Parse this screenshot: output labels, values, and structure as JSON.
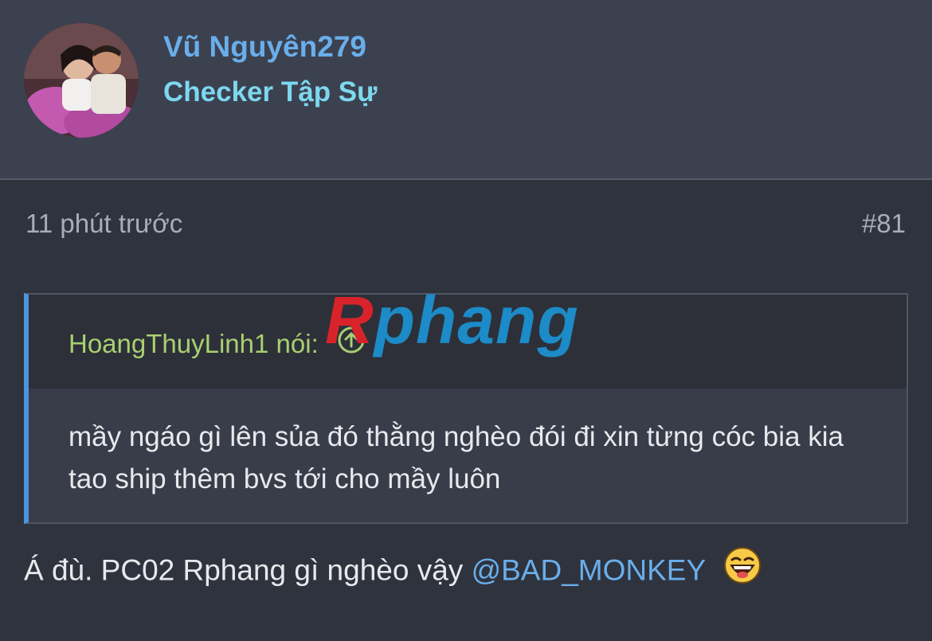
{
  "user": {
    "name": "Vũ Nguyên279",
    "title": "Checker Tập Sự"
  },
  "post": {
    "time": "11 phút trước",
    "number": "#81"
  },
  "quote": {
    "author": "HoangThuyLinh1",
    "said": "nói:",
    "arrow_icon": "arrow-up-circle-icon",
    "text": "mầy ngáo gì lên sủa đó thằng nghèo đói đi xin từng cóc bia kia tao ship thêm bvs tới cho mầy luôn"
  },
  "message": {
    "text": "Á đù. PC02 Rphang gì nghèo vậy",
    "mention": "@BAD_MONKEY",
    "emoji_icon": "laughing-emoji-icon"
  },
  "watermark": {
    "first": "R",
    "rest": "phang"
  },
  "colors": {
    "background": "#2f333e",
    "header": "#3c4150",
    "username": "#6aaeea",
    "user_title": "#7dd8ef",
    "quote_author": "#a7d070",
    "quote_border": "#4c95de"
  }
}
